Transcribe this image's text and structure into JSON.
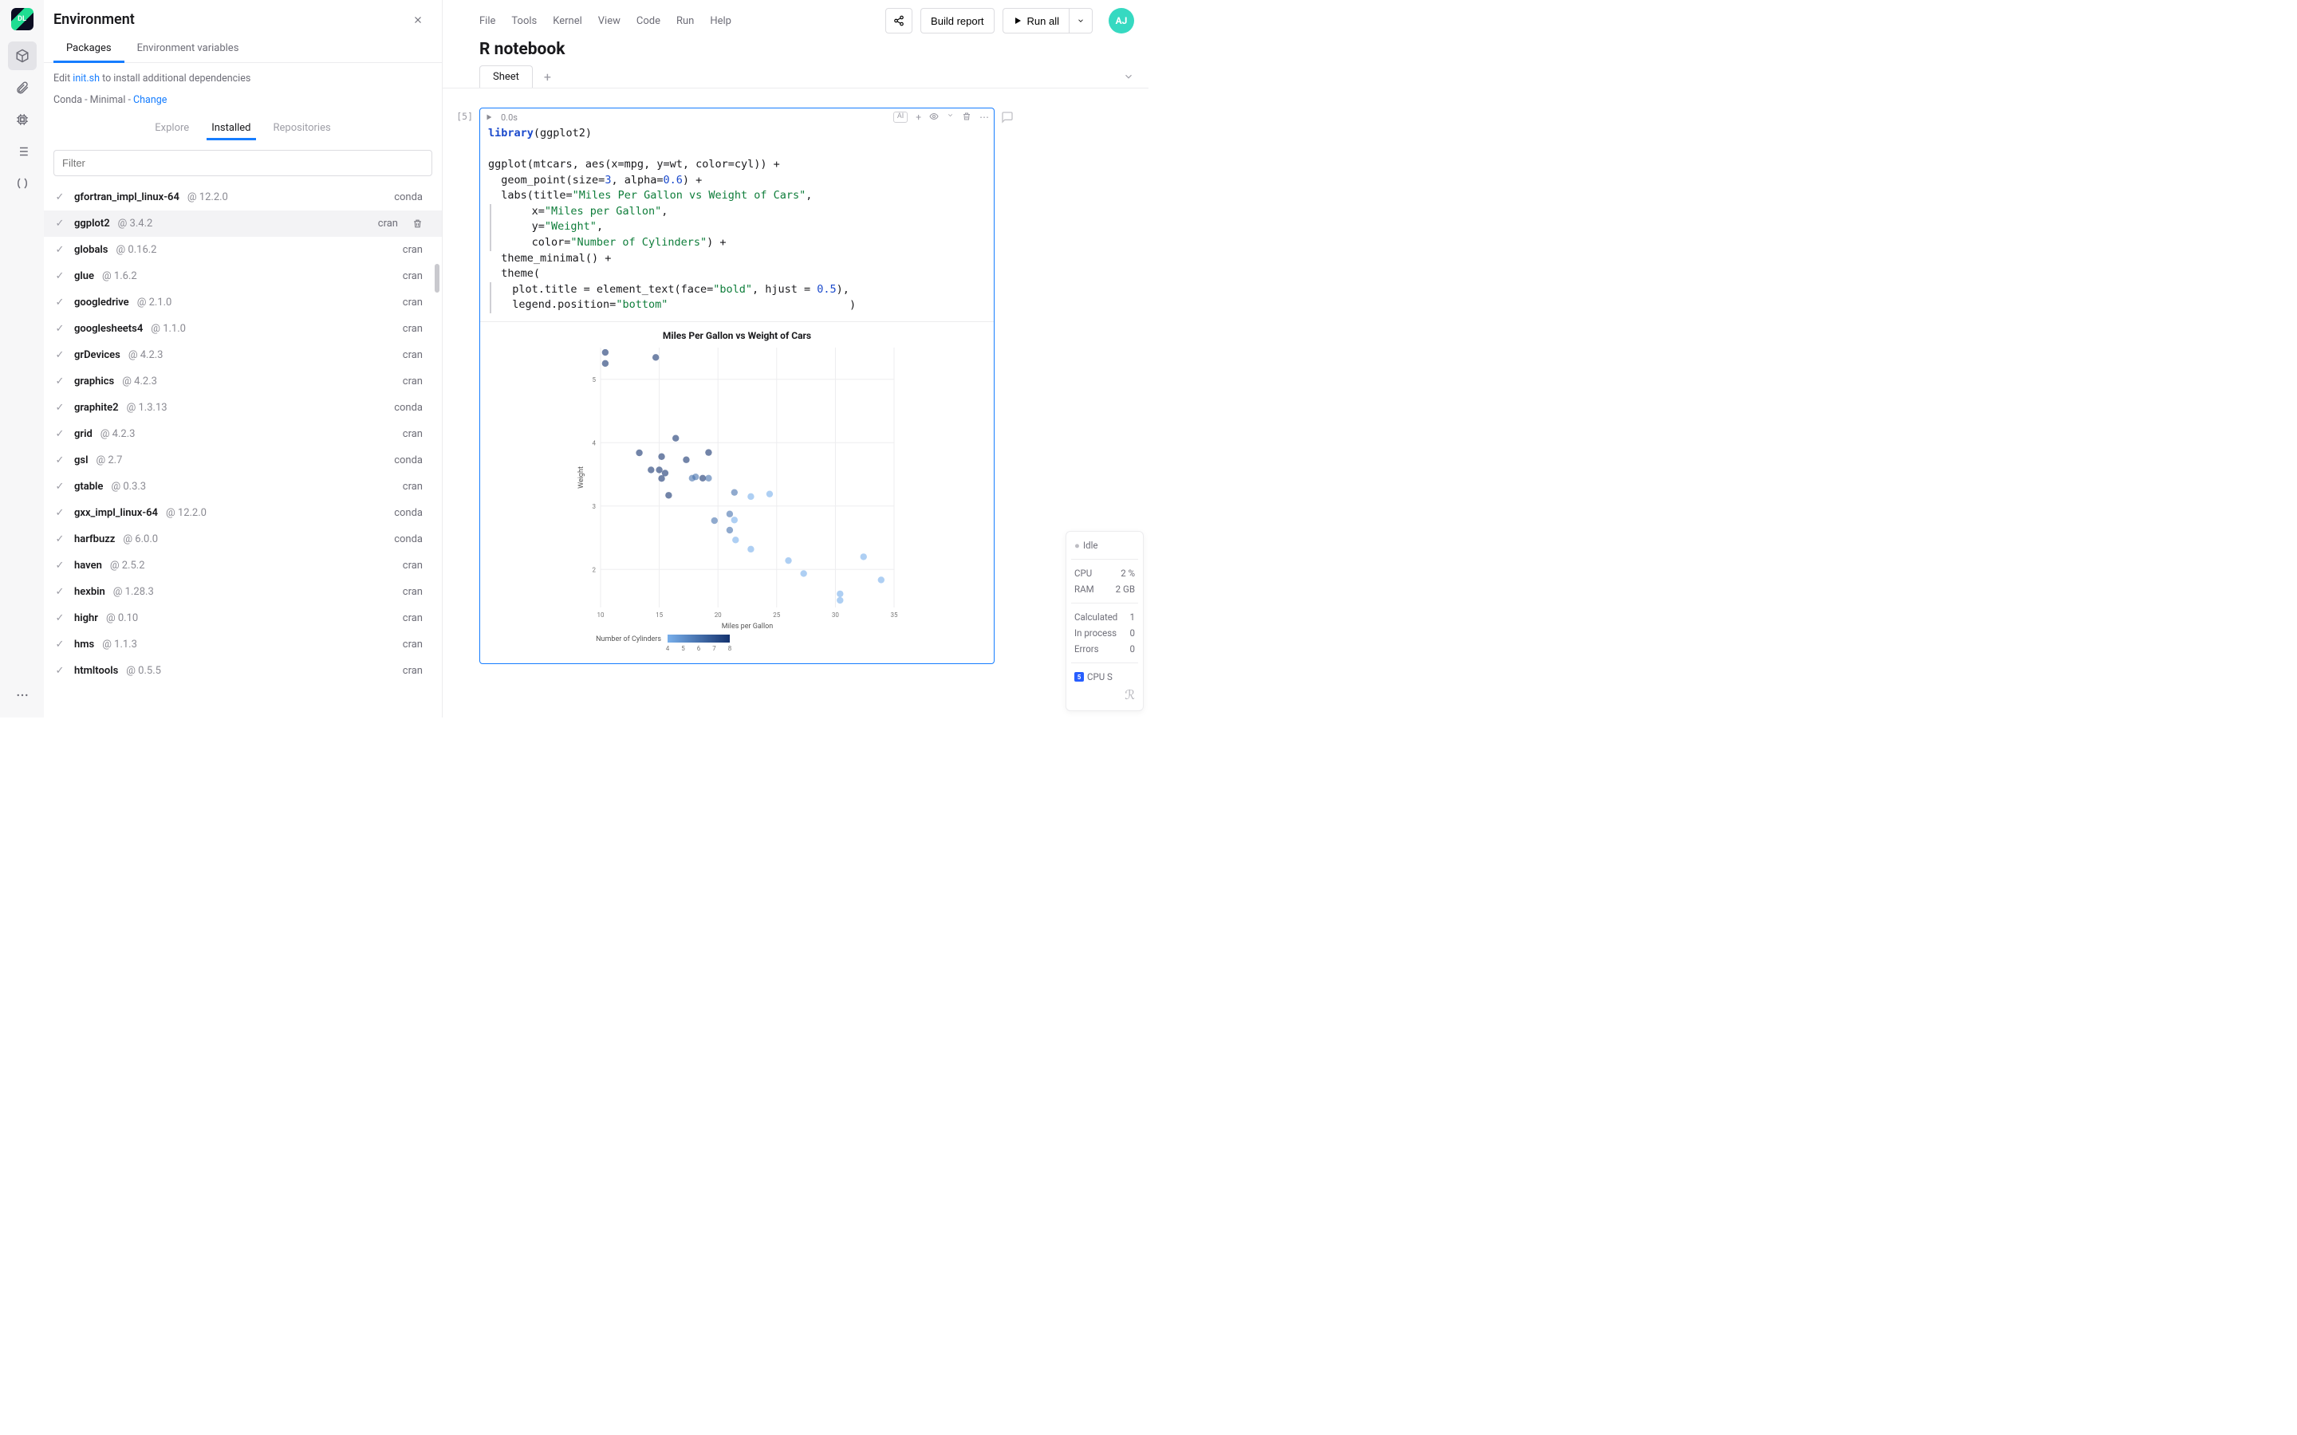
{
  "rail": {
    "logo": "DL"
  },
  "env": {
    "title": "Environment",
    "tabs": {
      "packages": "Packages",
      "vars": "Environment variables"
    },
    "hint_prefix": "Edit ",
    "hint_link": "init.sh",
    "hint_suffix": " to install additional dependencies",
    "conda_prefix": "Conda - Minimal - ",
    "conda_link": "Change",
    "sub_tabs": {
      "explore": "Explore",
      "installed": "Installed",
      "repositories": "Repositories"
    },
    "filter_placeholder": "Filter",
    "packages": [
      {
        "name": "gfortran_impl_linux-64",
        "version": "@ 12.2.0",
        "source": "conda"
      },
      {
        "name": "ggplot2",
        "version": "@ 3.4.2",
        "source": "cran",
        "hover": true
      },
      {
        "name": "globals",
        "version": "@ 0.16.2",
        "source": "cran"
      },
      {
        "name": "glue",
        "version": "@ 1.6.2",
        "source": "cran"
      },
      {
        "name": "googledrive",
        "version": "@ 2.1.0",
        "source": "cran"
      },
      {
        "name": "googlesheets4",
        "version": "@ 1.1.0",
        "source": "cran"
      },
      {
        "name": "grDevices",
        "version": "@ 4.2.3",
        "source": "cran"
      },
      {
        "name": "graphics",
        "version": "@ 4.2.3",
        "source": "cran"
      },
      {
        "name": "graphite2",
        "version": "@ 1.3.13",
        "source": "conda"
      },
      {
        "name": "grid",
        "version": "@ 4.2.3",
        "source": "cran"
      },
      {
        "name": "gsl",
        "version": "@ 2.7",
        "source": "conda"
      },
      {
        "name": "gtable",
        "version": "@ 0.3.3",
        "source": "cran"
      },
      {
        "name": "gxx_impl_linux-64",
        "version": "@ 12.2.0",
        "source": "conda"
      },
      {
        "name": "harfbuzz",
        "version": "@ 6.0.0",
        "source": "conda"
      },
      {
        "name": "haven",
        "version": "@ 2.5.2",
        "source": "cran"
      },
      {
        "name": "hexbin",
        "version": "@ 1.28.3",
        "source": "cran"
      },
      {
        "name": "highr",
        "version": "@ 0.10",
        "source": "cran"
      },
      {
        "name": "hms",
        "version": "@ 1.1.3",
        "source": "cran"
      },
      {
        "name": "htmltools",
        "version": "@ 0.5.5",
        "source": "cran"
      }
    ]
  },
  "menu": [
    "File",
    "Tools",
    "Kernel",
    "View",
    "Code",
    "Run",
    "Help"
  ],
  "toolbar": {
    "build": "Build report",
    "run_all": "Run all"
  },
  "avatar": "AJ",
  "notebook_title": "R notebook",
  "sheet_tab": "Sheet",
  "cell": {
    "index": "[5]",
    "time": "0.0s",
    "ai": "AI"
  },
  "status": {
    "idle": "Idle",
    "cpu_label": "CPU",
    "cpu_val": "2 %",
    "ram_label": "RAM",
    "ram_val": "2 GB",
    "calc_label": "Calculated",
    "calc_val": "1",
    "inproc_label": "In process",
    "inproc_val": "0",
    "err_label": "Errors",
    "err_val": "0",
    "badge_num": "5",
    "badge_txt": "CPU S"
  },
  "chart_data": {
    "type": "scatter",
    "title": "Miles Per Gallon vs Weight of Cars",
    "xlabel": "Miles per Gallon",
    "ylabel": "Weight",
    "color_label": "Number of Cylinders",
    "xlim": [
      10,
      35
    ],
    "ylim": [
      1.4,
      5.5
    ],
    "x_ticks": [
      10,
      15,
      20,
      25,
      30,
      35
    ],
    "y_ticks": [
      2,
      3,
      4,
      5
    ],
    "legend_ticks": [
      4,
      5,
      6,
      7,
      8
    ],
    "points": [
      {
        "mpg": 21.0,
        "wt": 2.62,
        "cyl": 6
      },
      {
        "mpg": 21.0,
        "wt": 2.875,
        "cyl": 6
      },
      {
        "mpg": 22.8,
        "wt": 2.32,
        "cyl": 4
      },
      {
        "mpg": 21.4,
        "wt": 3.215,
        "cyl": 6
      },
      {
        "mpg": 18.7,
        "wt": 3.44,
        "cyl": 8
      },
      {
        "mpg": 18.1,
        "wt": 3.46,
        "cyl": 6
      },
      {
        "mpg": 14.3,
        "wt": 3.57,
        "cyl": 8
      },
      {
        "mpg": 24.4,
        "wt": 3.19,
        "cyl": 4
      },
      {
        "mpg": 22.8,
        "wt": 3.15,
        "cyl": 4
      },
      {
        "mpg": 19.2,
        "wt": 3.44,
        "cyl": 6
      },
      {
        "mpg": 17.8,
        "wt": 3.44,
        "cyl": 6
      },
      {
        "mpg": 16.4,
        "wt": 4.07,
        "cyl": 8
      },
      {
        "mpg": 17.3,
        "wt": 3.73,
        "cyl": 8
      },
      {
        "mpg": 15.2,
        "wt": 3.78,
        "cyl": 8
      },
      {
        "mpg": 10.4,
        "wt": 5.25,
        "cyl": 8
      },
      {
        "mpg": 10.4,
        "wt": 5.424,
        "cyl": 8
      },
      {
        "mpg": 14.7,
        "wt": 5.345,
        "cyl": 8
      },
      {
        "mpg": 32.4,
        "wt": 2.2,
        "cyl": 4
      },
      {
        "mpg": 30.4,
        "wt": 1.615,
        "cyl": 4
      },
      {
        "mpg": 33.9,
        "wt": 1.835,
        "cyl": 4
      },
      {
        "mpg": 21.5,
        "wt": 2.465,
        "cyl": 4
      },
      {
        "mpg": 15.5,
        "wt": 3.52,
        "cyl": 8
      },
      {
        "mpg": 15.2,
        "wt": 3.435,
        "cyl": 8
      },
      {
        "mpg": 13.3,
        "wt": 3.84,
        "cyl": 8
      },
      {
        "mpg": 19.2,
        "wt": 3.845,
        "cyl": 8
      },
      {
        "mpg": 27.3,
        "wt": 1.935,
        "cyl": 4
      },
      {
        "mpg": 26.0,
        "wt": 2.14,
        "cyl": 4
      },
      {
        "mpg": 30.4,
        "wt": 1.513,
        "cyl": 4
      },
      {
        "mpg": 15.8,
        "wt": 3.17,
        "cyl": 8
      },
      {
        "mpg": 19.7,
        "wt": 2.77,
        "cyl": 6
      },
      {
        "mpg": 15.0,
        "wt": 3.57,
        "cyl": 8
      },
      {
        "mpg": 21.4,
        "wt": 2.78,
        "cyl": 4
      }
    ]
  }
}
